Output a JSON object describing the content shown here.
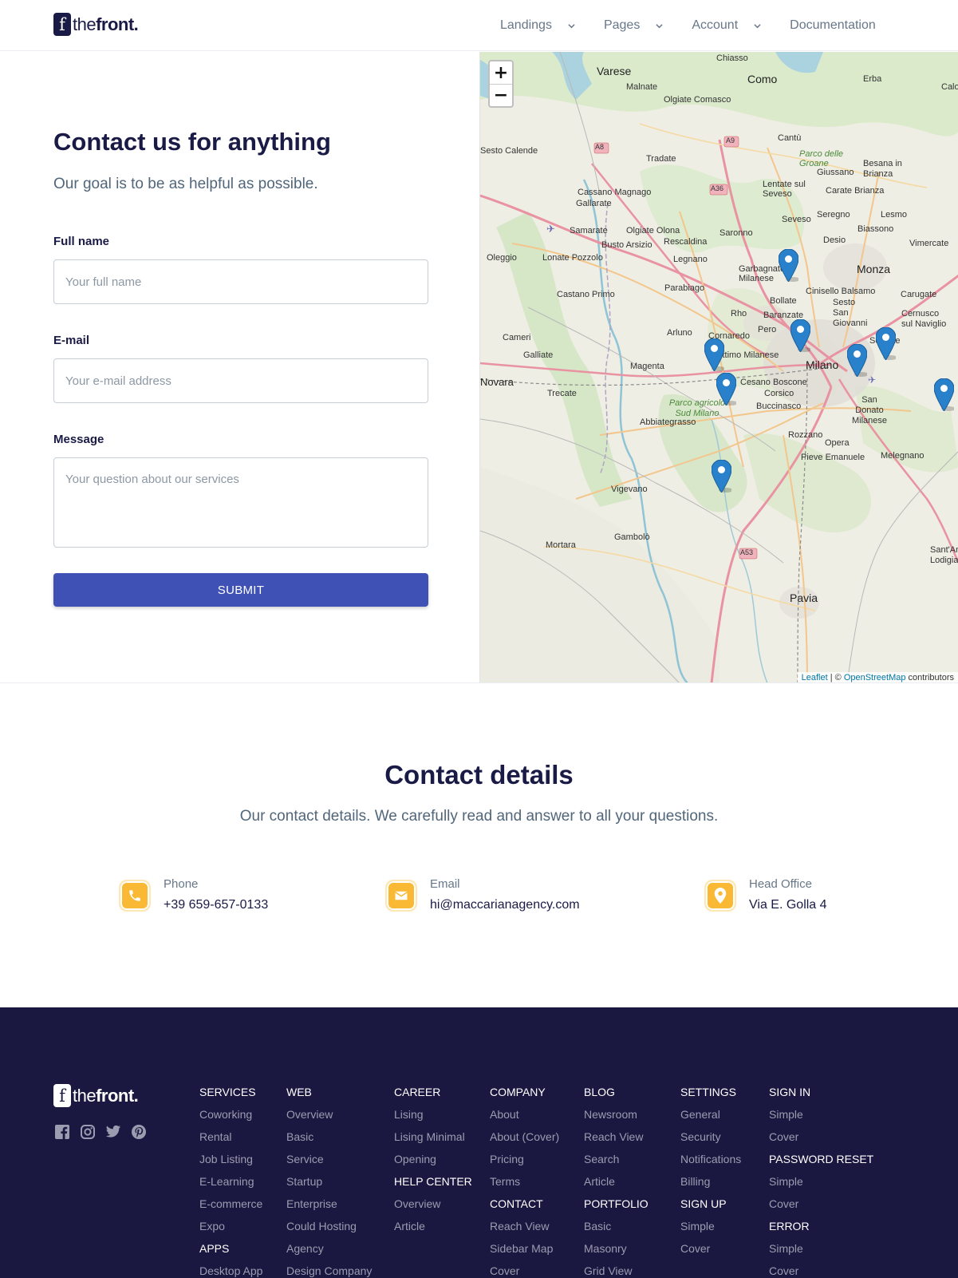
{
  "header": {
    "logo": {
      "mark": "f",
      "text_light": "the",
      "text_bold": "front."
    },
    "nav": [
      {
        "label": "Landings",
        "has_dropdown": true
      },
      {
        "label": "Pages",
        "has_dropdown": true
      },
      {
        "label": "Account",
        "has_dropdown": true
      },
      {
        "label": "Documentation",
        "has_dropdown": false
      }
    ]
  },
  "contact_form": {
    "title": "Contact us for anything",
    "subtitle": "Our goal is to be as helpful as possible.",
    "full_name": {
      "label": "Full name",
      "placeholder": "Your full name",
      "value": ""
    },
    "email": {
      "label": "E-mail",
      "placeholder": "Your e-mail address",
      "value": ""
    },
    "message": {
      "label": "Message",
      "placeholder": "Your question about our services",
      "value": ""
    },
    "submit_label": "SUBMIT"
  },
  "map": {
    "zoom_in": "+",
    "zoom_out": "−",
    "attribution": {
      "leaflet": "Leaflet",
      "separator": " | © ",
      "osm": "OpenStreetMap",
      "suffix": " contributors"
    },
    "place_labels": [
      "Varese",
      "Como",
      "Chiasso",
      "Erba",
      "Calolziocorte",
      "Malnate",
      "Olgiate Comasco",
      "Cantù",
      "Tradate",
      "Parco delle Groane",
      "Giussano",
      "Besana in Brianza",
      "Sesto Calende",
      "Cassano Magnago",
      "Gallarate",
      "Lentate sul Seveso",
      "Carate Brianza",
      "Seveso",
      "Seregno",
      "Lesmo",
      "Samarate",
      "Olgiate Olona",
      "Busto Arsizio",
      "Rescaldina",
      "Saronno",
      "Desio",
      "Biassono",
      "Vimercate",
      "Oleggio",
      "Lonate Pozzolo",
      "Legnano",
      "Garbagnate Milanese",
      "Monza",
      "Castano Primo",
      "Parabiago",
      "Cinisello Balsamo",
      "Carugate",
      "Rho",
      "Bollate",
      "Sesto San Giovanni",
      "Cernusco sul Naviglio",
      "Cameri",
      "Arluno",
      "Cornaredo",
      "Baranzate",
      "Pero",
      "Galliate",
      "Settimo Milanese",
      "Magenta",
      "Milano",
      "Segrate",
      "Novara",
      "Trecate",
      "Cesano Boscone",
      "Corsico",
      "Parco agricolo Sud Milano",
      "Buccinasco",
      "San Donato Milanese",
      "Abbiategrasso",
      "Rozzano",
      "Opera",
      "Pieve Emanuele",
      "Melegnano",
      "Vigevano",
      "Gambolò",
      "Mortara",
      "Sant'Angelo Lodigiano",
      "Pavia",
      "A8",
      "A9",
      "A36",
      "A53"
    ]
  },
  "contact_details": {
    "title": "Contact details",
    "subtitle": "Our contact details. We carefully read and answer to all your questions.",
    "items": [
      {
        "icon": "phone-icon",
        "label": "Phone",
        "value": "+39 659-657-0133"
      },
      {
        "icon": "email-icon",
        "label": "Email",
        "value": "hi@maccarianagency.com"
      },
      {
        "icon": "location-pin-icon",
        "label": "Head Office",
        "value": "Via E. Golla 4"
      }
    ]
  },
  "footer": {
    "logo": {
      "mark": "f",
      "text_light": "the",
      "text_bold": "front."
    },
    "socials": [
      "facebook-icon",
      "instagram-icon",
      "twitter-icon",
      "pinterest-icon"
    ],
    "columns": [
      {
        "groups": [
          {
            "title": "SERVICES",
            "links": [
              "Coworking",
              "Rental",
              "Job Listing",
              "E-Learning",
              "E-commerce",
              "Expo"
            ]
          },
          {
            "title": "APPS",
            "links": [
              "Desktop App"
            ]
          }
        ]
      },
      {
        "groups": [
          {
            "title": "WEB",
            "links": [
              "Overview",
              "Basic",
              "Service",
              "Startup",
              "Enterprise",
              "Could Hosting",
              "Agency",
              "Design Company"
            ]
          }
        ]
      },
      {
        "groups": [
          {
            "title": "CAREER",
            "links": [
              "Lising",
              "Lising Minimal",
              "Opening"
            ]
          },
          {
            "title": "HELP CENTER",
            "links": [
              "Overview",
              "Article"
            ]
          }
        ]
      },
      {
        "groups": [
          {
            "title": "COMPANY",
            "links": [
              "About",
              "About (Cover)",
              "Pricing",
              "Terms"
            ]
          },
          {
            "title": "CONTACT",
            "links": [
              "Reach View",
              "Sidebar Map",
              "Cover"
            ]
          }
        ]
      },
      {
        "groups": [
          {
            "title": "BLOG",
            "links": [
              "Newsroom",
              "Reach View",
              "Search",
              "Article"
            ]
          },
          {
            "title": "PORTFOLIO",
            "links": [
              "Basic",
              "Masonry",
              "Grid View"
            ]
          }
        ]
      },
      {
        "groups": [
          {
            "title": "SETTINGS",
            "links": [
              "General",
              "Security",
              "Notifications",
              "Billing"
            ]
          },
          {
            "title": "SIGN UP",
            "links": [
              "Simple",
              "Cover"
            ]
          }
        ]
      },
      {
        "groups": [
          {
            "title": "SIGN IN",
            "links": [
              "Simple",
              "Cover"
            ]
          },
          {
            "title": "PASSWORD RESET",
            "links": [
              "Simple",
              "Cover"
            ]
          },
          {
            "title": "ERROR",
            "links": [
              "Simple",
              "Cover"
            ]
          }
        ]
      }
    ]
  },
  "colors": {
    "primary": "#3f51b5",
    "heading": "#1a1a46",
    "muted": "#677788",
    "accent_icon": "#f9b934",
    "footer_bg": "#1a1840",
    "marker": "#2a81cb"
  }
}
